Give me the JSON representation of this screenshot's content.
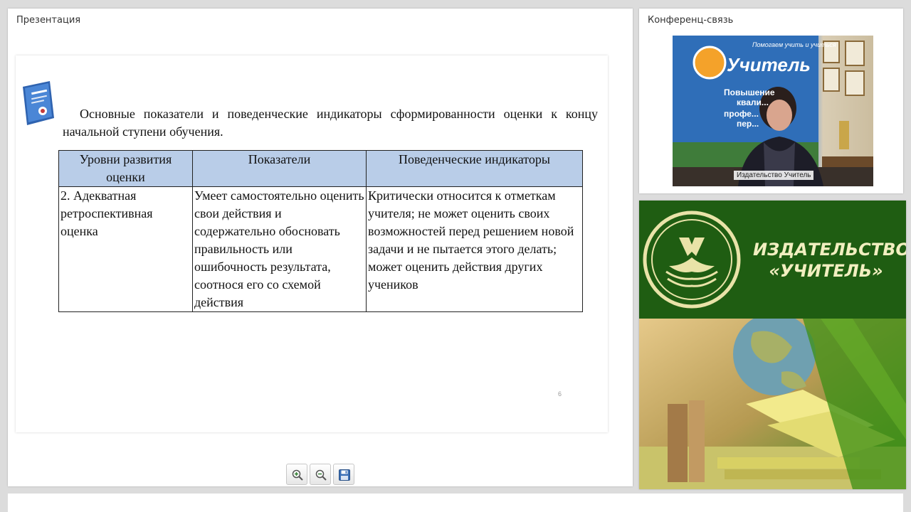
{
  "presentation": {
    "title": "Презентация",
    "slide": {
      "heading": "Основные показатели и поведенческие индикаторы сформированности оценки к концу начальной ступени обучения.",
      "table": {
        "headers": [
          "Уровни развития оценки",
          "Показатели",
          "Поведенческие индикаторы"
        ],
        "rows": [
          [
            "2. Адекватная ретроспективная оценка",
            "Умеет самостоятельно оценить свои действия и содержательно обосновать правильность или ошибочность результата, соотнося его со схемой действия",
            "Критически относится к отметкам учителя; не может оценить своих возможностей перед решением новой задачи и не пытается этого делать; может оценить действия других учеников"
          ]
        ]
      },
      "page_number": "6"
    },
    "toolbar": [
      {
        "name": "zoom-in-button",
        "icon": "zoom-in-icon"
      },
      {
        "name": "zoom-out-button",
        "icon": "zoom-out-icon"
      },
      {
        "name": "save-button",
        "icon": "floppy-disk-icon"
      }
    ]
  },
  "conference": {
    "title": "Конференц-связь",
    "video": {
      "participant_name": "Издательство Учитель",
      "backdrop_lines": [
        "Помогаем учить и учиться",
        "Учитель",
        "Повышение",
        "квали...",
        "профе...",
        "пер..."
      ]
    }
  },
  "banner": {
    "publisher_line1": "ИЗДАТЕЛЬСТВО",
    "publisher_line2": "«УЧИТЕЛЬ»",
    "colors": {
      "green_dark": "#1f5d12",
      "cream": "#f2efc0"
    }
  }
}
